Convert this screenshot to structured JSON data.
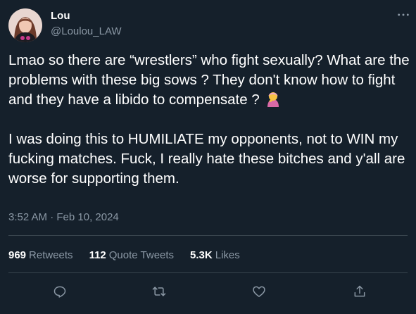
{
  "author": {
    "name": "Lou",
    "handle": "@Loulou_LAW",
    "avatar_icon": "profile-photo"
  },
  "tweet": {
    "paragraph1": "Lmao so there are “wrestlers” who fight sexually? What are the problems with these big sows ? They don't know how to fight and they have a libido to compensate ?",
    "paragraph1_emoji": "person-facepalming-emoji",
    "paragraph2": "I was doing this to HUMILIATE my opponents, not to WIN my fucking matches. Fuck, I really hate these bitches and y'all are worse for supporting them.",
    "timestamp": "3:52 AM · Feb 10, 2024"
  },
  "stats": {
    "retweets_count": "969",
    "retweets_label": "Retweets",
    "quotes_count": "112",
    "quotes_label": "Quote Tweets",
    "likes_count": "5.3K",
    "likes_label": "Likes"
  },
  "actions": {
    "reply_icon": "reply-icon",
    "retweet_icon": "retweet-icon",
    "like_icon": "like-icon",
    "share_icon": "share-icon",
    "more_icon": "more-icon"
  },
  "colors": {
    "background": "#15202b",
    "text_primary": "#ffffff",
    "text_secondary": "#8b98a5",
    "divider": "#38444d"
  }
}
